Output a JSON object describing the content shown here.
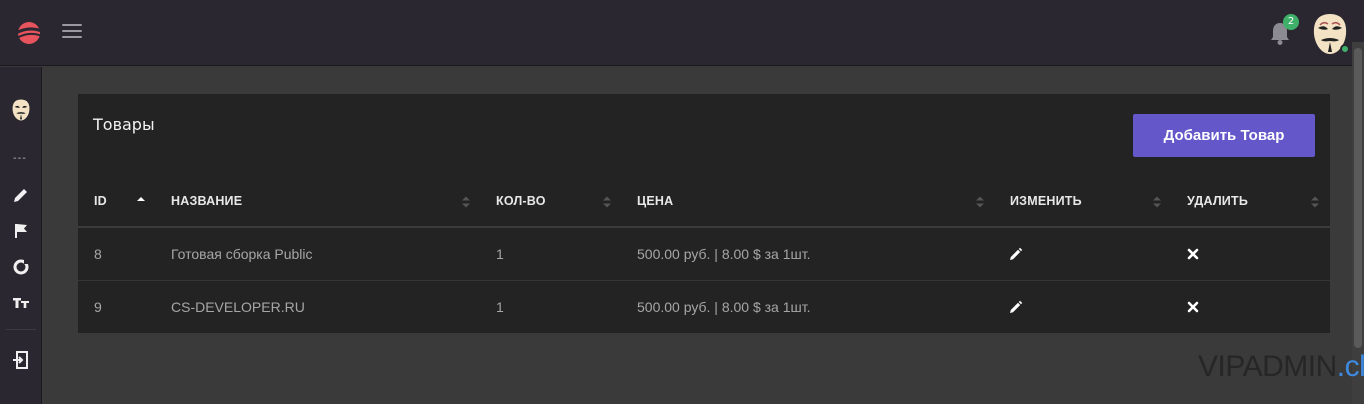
{
  "topbar": {
    "notifications_count": "2"
  },
  "sidebar": {
    "dots": "---"
  },
  "card": {
    "title": "Товары",
    "add_button": "Добавить Товар"
  },
  "table": {
    "columns": [
      "ID",
      "НАЗВАНИЕ",
      "КОЛ-ВО",
      "ЦЕНА",
      "ИЗМЕНИТЬ",
      "УДАЛИТЬ"
    ],
    "sorted_column": "ID",
    "rows": [
      {
        "id": "8",
        "name": "Готовая сборка Public",
        "qty": "1",
        "price": "500.00 руб. | 8.00 $ за 1шт."
      },
      {
        "id": "9",
        "name": "CS-DEVELOPER.RU",
        "qty": "1",
        "price": "500.00 руб. | 8.00 $ за 1шт."
      }
    ]
  },
  "watermark": {
    "part1": "VIPADMIN",
    "part2": ".club"
  },
  "colors": {
    "accent": "#6457c9",
    "badge": "#3fb06a"
  }
}
